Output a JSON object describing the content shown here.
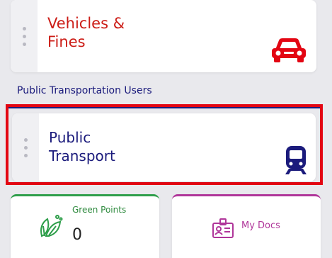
{
  "cards": {
    "vehicles": {
      "title": "Vehicles &\nFines",
      "icon": "car-icon",
      "color": "#cc1c16"
    },
    "transport": {
      "title": "Public\nTransport",
      "icon": "train-icon",
      "color": "#1b1b7c"
    }
  },
  "section": {
    "label": "Public Transportation Users"
  },
  "tiles": {
    "green_points": {
      "title": "Green Points",
      "count": "0",
      "icon": "leaf-icon",
      "color": "#2e9e4a"
    },
    "my_docs": {
      "label": "My Docs",
      "icon": "document-id-icon",
      "color": "#b0369a"
    }
  },
  "highlight": {
    "color": "#e30613"
  }
}
